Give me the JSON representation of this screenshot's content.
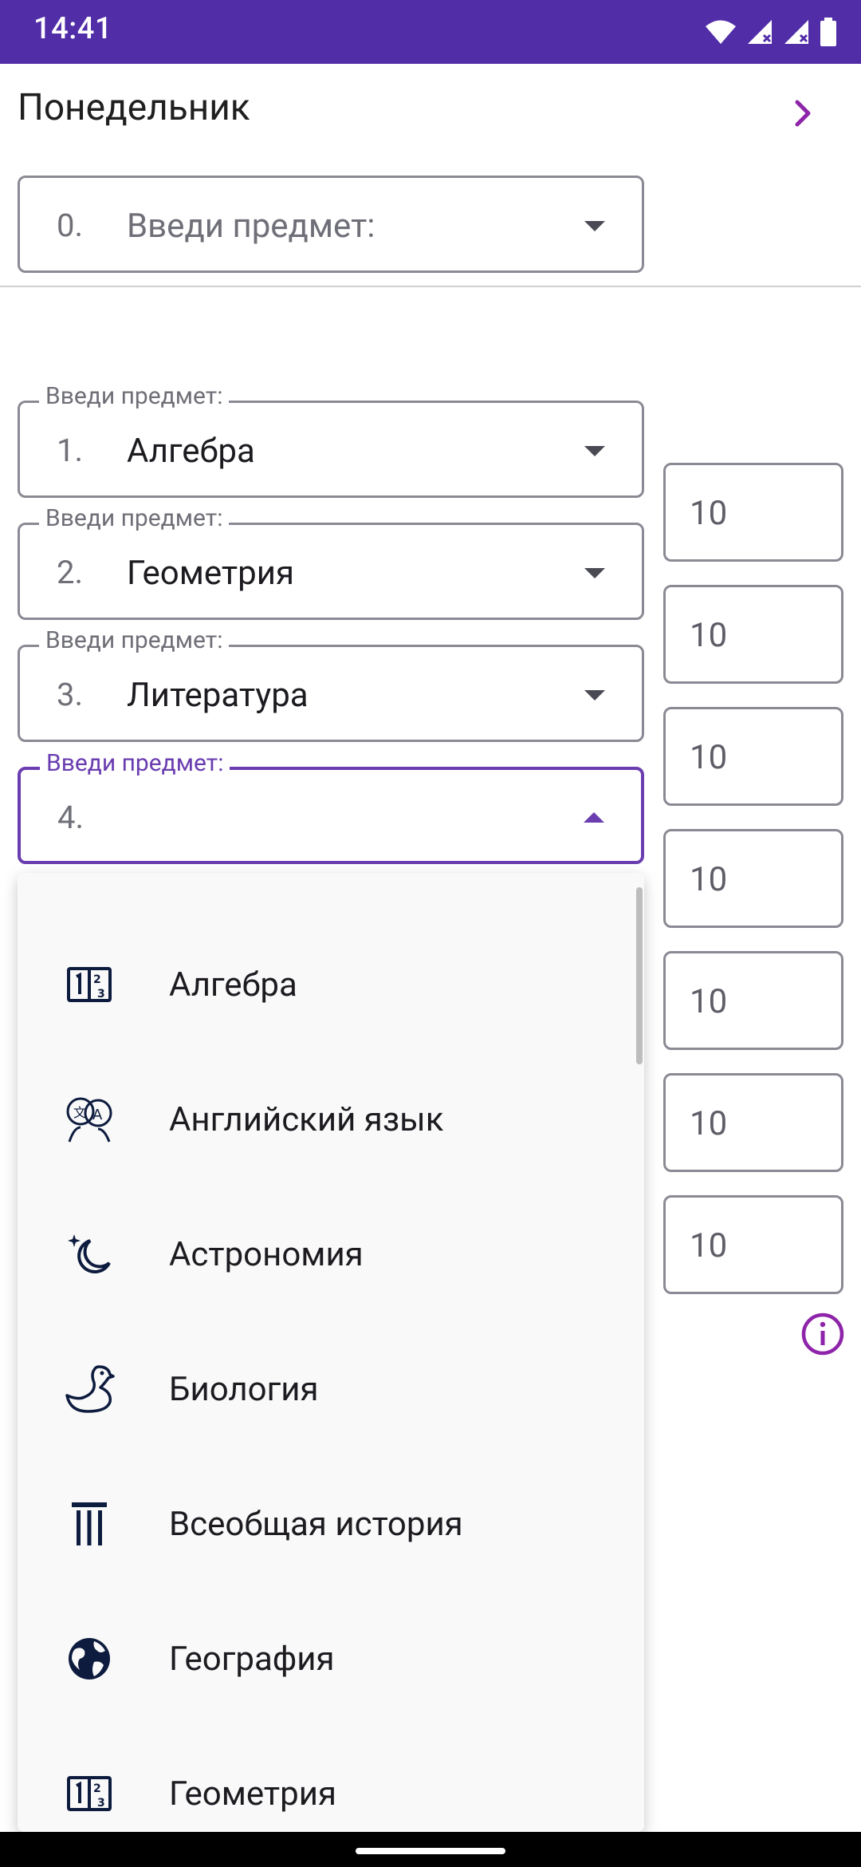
{
  "status_bar": {
    "time": "14:41",
    "background": "#512da8",
    "icons": [
      "wifi-icon",
      "signal-icon",
      "signal-icon",
      "battery-icon"
    ]
  },
  "header": {
    "day_title": "Понедельник",
    "next_icon": "chevron-right-icon",
    "accent": "#8e24aa"
  },
  "subject_placeholder": "Введи предмет:",
  "lesson_zero": {
    "number": "0.",
    "placeholder": "Введи предмет:"
  },
  "lessons": [
    {
      "number": "1.",
      "subject": "Алгебра",
      "legend": "Введи предмет:"
    },
    {
      "number": "2.",
      "subject": "Геометрия",
      "legend": "Введи предмет:"
    },
    {
      "number": "3.",
      "subject": "Литература",
      "legend": "Введи предмет:"
    },
    {
      "number": "4.",
      "subject": "",
      "legend": "Введи предмет:"
    }
  ],
  "grades": [
    "10",
    "10",
    "10",
    "10",
    "10",
    "10",
    "10"
  ],
  "info_icon": "info-icon",
  "dropdown": {
    "items": [
      {
        "label": "Алгебра",
        "icon": "algebra-icon"
      },
      {
        "label": "Английский язык",
        "icon": "language-icon"
      },
      {
        "label": "Астрономия",
        "icon": "moon-star-icon"
      },
      {
        "label": "Биология",
        "icon": "duck-icon"
      },
      {
        "label": "Всеобщая история",
        "icon": "pillar-icon"
      },
      {
        "label": "География",
        "icon": "globe-icon"
      },
      {
        "label": "Геометрия",
        "icon": "geometry-icon"
      }
    ]
  },
  "colors": {
    "primary": "#512da8",
    "focus": "#6a3db0",
    "outline": "#8a8a94",
    "text": "#1d1b20"
  }
}
